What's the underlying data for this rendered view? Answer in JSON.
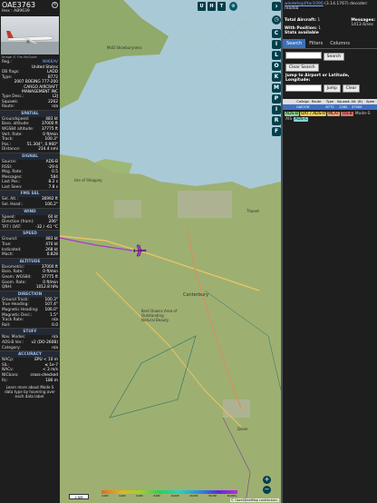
{
  "aircraft": {
    "callsign": "OAE3763",
    "hex_line": "Hex : AB9639",
    "photo_credit": "Image © Tim McGuire",
    "reg_label": "Reg.:",
    "reg": "N966AV",
    "country": "United States",
    "db_flags_label": "DB flags:",
    "db_flags": "LADD",
    "type_label": "Type:",
    "type": "B772",
    "model": "2007 BOEING 777-200",
    "owner": "CARGO AIRCRAFT MANAGEMENT INC",
    "type_desc_label": "Type Desc.:",
    "type_desc": "L2J",
    "squawk_label": "Squawk:",
    "squawk": "2262",
    "route_label": "Route:",
    "route": "n/a"
  },
  "sections": [
    {
      "title": "SPATIAL",
      "rows": [
        {
          "k": "Groundspeed:",
          "v": "483 kt"
        },
        {
          "k": "Baro. altitude:",
          "v": "37000 ft"
        },
        {
          "k": "WGS84 altitude:",
          "v": "37775 ft"
        },
        {
          "k": "Vert. Rate:",
          "v": "0 ft/min"
        },
        {
          "k": "Track:",
          "v": "100.3°"
        },
        {
          "k": "Pos.:",
          "v": "51.304°, 0.960°"
        },
        {
          "k": "Distance:",
          "v": "214.4 nmi"
        }
      ]
    },
    {
      "title": "SIGNAL",
      "rows": [
        {
          "k": "Source:",
          "v": "ADS-B"
        },
        {
          "k": "RSSI:",
          "v": "-29.6"
        },
        {
          "k": "Msg. Rate:",
          "v": "0.5"
        },
        {
          "k": "Messages:",
          "v": "584"
        },
        {
          "k": "Last Pos.:",
          "v": "8.2 s"
        },
        {
          "k": "Last Seen:",
          "v": "7.8 s"
        }
      ]
    },
    {
      "title": "FMS SEL",
      "rows": [
        {
          "k": "Sel. Alt.:",
          "v": "36992 ft"
        },
        {
          "k": "Sel. Head.:",
          "v": "106.2°"
        }
      ]
    },
    {
      "title": "WIND",
      "rows": [
        {
          "k": "Speed:",
          "v": "60 kt"
        },
        {
          "k": "Direction (from):",
          "v": "206°"
        },
        {
          "k": "TAT / OAT:",
          "v": "-32 / -61 °C"
        }
      ]
    },
    {
      "title": "SPEED",
      "rows": [
        {
          "k": "Ground:",
          "v": "483 kt"
        },
        {
          "k": "True:",
          "v": "470 kt"
        },
        {
          "k": "Indicated:",
          "v": "268 kt"
        },
        {
          "k": "Mach:",
          "v": "0.828"
        }
      ]
    },
    {
      "title": "ALTITUDE",
      "rows": [
        {
          "k": "Barometric:",
          "v": "37000 ft"
        },
        {
          "k": "Baro. Rate:",
          "v": "0 ft/min"
        },
        {
          "k": "Geom. WGS84:",
          "v": "37775 ft"
        },
        {
          "k": "Geom. Rate:",
          "v": "0 ft/min"
        },
        {
          "k": "QNH:",
          "v": "1012.8 hPa"
        }
      ]
    },
    {
      "title": "DIRECTION",
      "rows": [
        {
          "k": "Ground Track:",
          "v": "100.3°"
        },
        {
          "k": "True Heading:",
          "v": "107.4°"
        },
        {
          "k": "Magnetic Heading:",
          "v": "106.0°"
        },
        {
          "k": "Magnetic Decl.:",
          "v": "1.5°"
        },
        {
          "k": "Track Rate:",
          "v": "n/a"
        },
        {
          "k": "Roll:",
          "v": "0.0"
        }
      ]
    },
    {
      "title": "STUFF",
      "rows": [
        {
          "k": "Nav. Modes:",
          "v": "n/a"
        },
        {
          "k": "ADS-B Ver.:",
          "v": "v2 (DO-260B)"
        },
        {
          "k": "Category:",
          "v": "n/a"
        }
      ]
    },
    {
      "title": "ACCURACY",
      "rows": [
        {
          "k": "NACp:",
          "v": "EPU < 10 m"
        },
        {
          "k": "SIL:",
          "v": "≤ 1e-7"
        },
        {
          "k": "NACv:",
          "v": "< 3 m/s"
        },
        {
          "k": "NICbaro:",
          "v": "cross-checked"
        },
        {
          "k": "Rc:",
          "v": "186 m"
        }
      ]
    }
  ],
  "info_text": "Learn more about Mode S data type by hovering over each data label.",
  "right": {
    "decoder_link": "wiedehopf/tar1090",
    "decoder_version": "(3.14.1767) decoder: readsb",
    "total_label": "Total Aircraft:",
    "total": "1",
    "messages_label": "Messages:",
    "messages": "1413.6/sec",
    "with_pos_label": "With Position:",
    "with_pos": "1",
    "stats": "Stats available",
    "tabs": [
      "Search",
      "Filters",
      "Columns"
    ],
    "search_btn": "Search",
    "clear_search_btn": "Clear Search",
    "jump_label": "Jump to Airport or Latitude, Longitude:",
    "jump_btn": "Jump",
    "clear_btn": "Clear",
    "columns": [
      "",
      "Callsign",
      "Route",
      "Type",
      "Squawk",
      "Alt. (ft)",
      "Spee"
    ],
    "row": [
      "",
      "OAE3763",
      "",
      "B772",
      "2262",
      "37000",
      ""
    ],
    "badges": [
      {
        "label": "ADS-B",
        "bg": "#8fd18f",
        "fg": "#000"
      },
      {
        "label": "UAT / ADS-R",
        "bg": "#e6c95a",
        "fg": "#000"
      },
      {
        "label": "MLAT",
        "bg": "#f0a070",
        "fg": "#000"
      },
      {
        "label": "TIS-B",
        "bg": "#e07070",
        "fg": "#000"
      },
      {
        "label": "Mode-S",
        "bg": "#1e1e1e",
        "fg": "#ccc"
      },
      {
        "label": "AIS",
        "bg": "#1e1e1e",
        "fg": "#ccc"
      },
      {
        "label": "ADS-C",
        "bg": "#7fd5d5",
        "fg": "#000"
      }
    ]
  },
  "map": {
    "labels": [
      {
        "t": "MoD Shoeburyness"
      },
      {
        "t": "Isle of Sheppey"
      },
      {
        "t": "Canterbury"
      },
      {
        "t": "Kent Downs Area of Outstanding Natural Beauty"
      },
      {
        "t": "Thanet"
      },
      {
        "t": "Dover"
      }
    ],
    "attribution": "© OpenStreetMap contributors.",
    "scale": "2 NM",
    "colorbar_ticks": [
      "2,000",
      "4,000",
      "6,000",
      "8,000",
      "10,000",
      "20,000",
      "30,000",
      "40,000+"
    ],
    "buttons_top": [
      "U",
      "H",
      "T"
    ],
    "strip_buttons": [
      "C",
      "I",
      "L",
      "O",
      "K",
      "M",
      "P",
      "I",
      "R",
      "F"
    ]
  },
  "colors": {
    "accent": "#3a71b8",
    "panel": "#1e1e1e",
    "button": "#003f4b",
    "track": "#a53ad0"
  }
}
